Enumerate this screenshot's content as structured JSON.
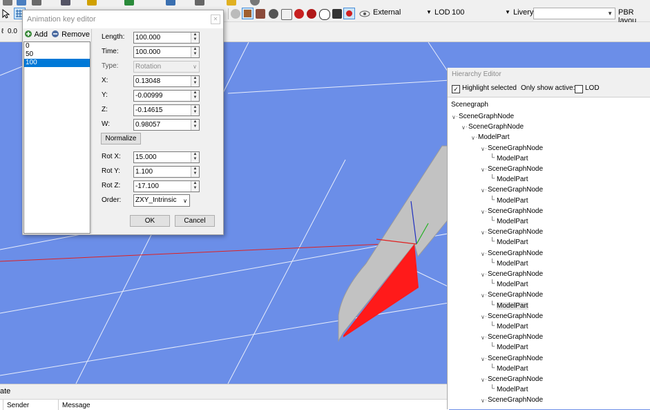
{
  "toolbar": {
    "coord_value": "0.0",
    "view_mode": "External",
    "lod_label": "LOD",
    "lod_value": "100",
    "livery_label": "Livery",
    "livery_value": "",
    "pbr_label": "PBR layou"
  },
  "anim_key_editor": {
    "title": "Animation key editor",
    "add_label": "Add",
    "remove_label": "Remove",
    "keys": [
      "0",
      "50",
      "100"
    ],
    "selected_key": "100",
    "fields": {
      "length": {
        "label": "Length:",
        "value": "100.000"
      },
      "time": {
        "label": "Time:",
        "value": "100.000"
      },
      "type": {
        "label": "Type:",
        "value": "Rotation"
      },
      "x": {
        "label": "X:",
        "value": "0.13048"
      },
      "y": {
        "label": "Y:",
        "value": "-0.00999"
      },
      "z": {
        "label": "Z:",
        "value": "-0.14615"
      },
      "w": {
        "label": "W:",
        "value": "0.98057"
      },
      "rot_x": {
        "label": "Rot X:",
        "value": "15.000"
      },
      "rot_y": {
        "label": "Rot Y:",
        "value": "1.100"
      },
      "rot_z": {
        "label": "Rot Z:",
        "value": "-17.100"
      },
      "order": {
        "label": "Order:",
        "value": "ZXY_Intrinsic"
      }
    },
    "normalize_label": "Normalize",
    "ok_label": "OK",
    "cancel_label": "Cancel"
  },
  "hierarchy_editor": {
    "title": "Hierarchy Editor",
    "highlight_selected_label": "Highlight selected",
    "highlight_selected_checked": true,
    "only_show_active_label": "Only show active:",
    "lod_label": "LOD",
    "lod_checked": false,
    "root_label": "Scenegraph",
    "nodes": [
      {
        "label": "SceneGraphNode",
        "level": 0,
        "toggle": true
      },
      {
        "label": "SceneGraphNode",
        "level": 1,
        "toggle": true
      },
      {
        "label": "ModelPart",
        "level": 2,
        "toggle": true
      },
      {
        "label": "SceneGraphNode",
        "level": 3,
        "toggle": true
      },
      {
        "label": "ModelPart",
        "level": 4,
        "toggle": false
      },
      {
        "label": "SceneGraphNode",
        "level": 3,
        "toggle": true
      },
      {
        "label": "ModelPart",
        "level": 4,
        "toggle": false
      },
      {
        "label": "SceneGraphNode",
        "level": 3,
        "toggle": true
      },
      {
        "label": "ModelPart",
        "level": 4,
        "toggle": false
      },
      {
        "label": "SceneGraphNode",
        "level": 3,
        "toggle": true
      },
      {
        "label": "ModelPart",
        "level": 4,
        "toggle": false
      },
      {
        "label": "SceneGraphNode",
        "level": 3,
        "toggle": true
      },
      {
        "label": "ModelPart",
        "level": 4,
        "toggle": false
      },
      {
        "label": "SceneGraphNode",
        "level": 3,
        "toggle": true
      },
      {
        "label": "ModelPart",
        "level": 4,
        "toggle": false
      },
      {
        "label": "SceneGraphNode",
        "level": 3,
        "toggle": true
      },
      {
        "label": "ModelPart",
        "level": 4,
        "toggle": false
      },
      {
        "label": "SceneGraphNode",
        "level": 3,
        "toggle": true
      },
      {
        "label": "ModelPart",
        "level": 4,
        "toggle": false,
        "highlight": true
      },
      {
        "label": "SceneGraphNode",
        "level": 3,
        "toggle": true
      },
      {
        "label": "ModelPart",
        "level": 4,
        "toggle": false
      },
      {
        "label": "SceneGraphNode",
        "level": 3,
        "toggle": true
      },
      {
        "label": "ModelPart",
        "level": 4,
        "toggle": false
      },
      {
        "label": "SceneGraphNode",
        "level": 3,
        "toggle": true
      },
      {
        "label": "ModelPart",
        "level": 4,
        "toggle": false
      },
      {
        "label": "SceneGraphNode",
        "level": 3,
        "toggle": true
      },
      {
        "label": "ModelPart",
        "level": 4,
        "toggle": false
      },
      {
        "label": "SceneGraphNode",
        "level": 3,
        "toggle": true
      }
    ]
  },
  "log_panel": {
    "title": "ate",
    "col_sender": "Sender",
    "col_message": "Message"
  },
  "colors": {
    "viewport_bg": "#6b8ee8",
    "selection": "#0078d7",
    "highlight_part": "#ff1a1a"
  }
}
